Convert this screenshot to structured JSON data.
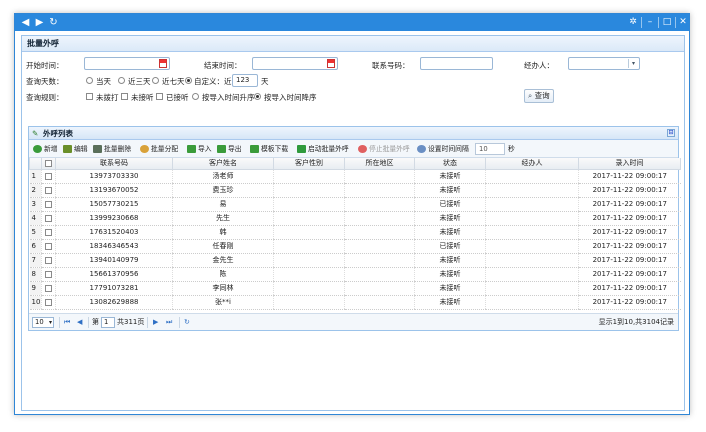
{
  "titlebar": {
    "back_icon": "◀",
    "forward_icon": "▶",
    "refresh_icon": "↻",
    "settings_icon": "✲",
    "minimize_icon": "–",
    "maximize_icon": "□",
    "close_icon": "✕"
  },
  "panel": {
    "title": "批量外呼",
    "form": {
      "start_time_label": "开始时间：",
      "end_time_label": "结束时间：",
      "phone_label": "联系号码：",
      "agent_label": "经办人：",
      "days_label": "查询天数：",
      "days_options": [
        "当天",
        "近三天",
        "近七天",
        "自定义：近"
      ],
      "days_selected": 3,
      "custom_days_value": "123",
      "days_unit": "天",
      "rules_label": "查询规则：",
      "rule_checks": [
        "未拨打",
        "未接听",
        "已接听"
      ],
      "order_options": [
        "按导入时间升序",
        "按导入时间降序"
      ],
      "order_selected": 1,
      "query_button": "查询"
    }
  },
  "grid": {
    "title": "外呼列表",
    "collapse_icon": "⊟",
    "toolbar": {
      "buttons": [
        "新增",
        "编辑",
        "批量删除",
        "批量分配",
        "导入",
        "导出",
        "模板下载",
        "启动批量外呼",
        "停止批量外呼",
        "设置时间间隔"
      ],
      "interval_value": "10",
      "interval_unit": "秒"
    },
    "columns": [
      "联系号码",
      "客户姓名",
      "客户性别",
      "所在地区",
      "状态",
      "经办人",
      "录入时间"
    ],
    "rows": [
      {
        "n": "1",
        "phone": "13973703330",
        "name": "汤老师",
        "gender": "",
        "region": "",
        "status": "未接听",
        "agent": "",
        "time": "2017-11-22 09:00:17"
      },
      {
        "n": "2",
        "phone": "13193670052",
        "name": "费玉珍",
        "gender": "",
        "region": "",
        "status": "未接听",
        "agent": "",
        "time": "2017-11-22 09:00:17"
      },
      {
        "n": "3",
        "phone": "15057730215",
        "name": "易",
        "gender": "",
        "region": "",
        "status": "已接听",
        "agent": "",
        "time": "2017-11-22 09:00:17"
      },
      {
        "n": "4",
        "phone": "13999230668",
        "name": "先生",
        "gender": "",
        "region": "",
        "status": "未接听",
        "agent": "",
        "time": "2017-11-22 09:00:17"
      },
      {
        "n": "5",
        "phone": "17631520403",
        "name": "韩",
        "gender": "",
        "region": "",
        "status": "未接听",
        "agent": "",
        "time": "2017-11-22 09:00:17"
      },
      {
        "n": "6",
        "phone": "18346346543",
        "name": "任春刚",
        "gender": "",
        "region": "",
        "status": "已接听",
        "agent": "",
        "time": "2017-11-22 09:00:17"
      },
      {
        "n": "7",
        "phone": "13940140979",
        "name": "金先生",
        "gender": "",
        "region": "",
        "status": "未接听",
        "agent": "",
        "time": "2017-11-22 09:00:17"
      },
      {
        "n": "8",
        "phone": "15661370956",
        "name": "陈",
        "gender": "",
        "region": "",
        "status": "未接听",
        "agent": "",
        "time": "2017-11-22 09:00:17"
      },
      {
        "n": "9",
        "phone": "17791073281",
        "name": "李同林",
        "gender": "",
        "region": "",
        "status": "未接听",
        "agent": "",
        "time": "2017-11-22 09:00:17"
      },
      {
        "n": "10",
        "phone": "13082629888",
        "name": "张**i",
        "gender": "",
        "region": "",
        "status": "未接听",
        "agent": "",
        "time": "2017-11-22 09:00:17"
      }
    ],
    "pager": {
      "page_size": "10",
      "page_prefix": "第",
      "page_value": "1",
      "page_total": "共311页",
      "summary": "显示1到10,共3104记录"
    }
  }
}
